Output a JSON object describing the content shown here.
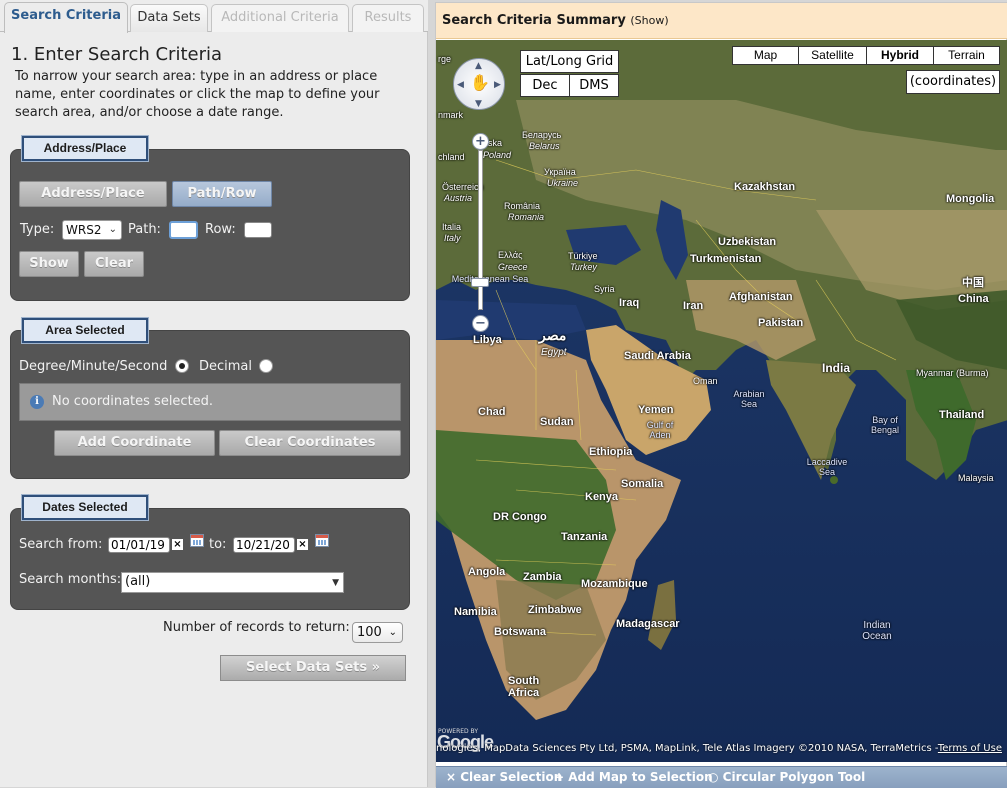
{
  "tabs": [
    {
      "label": "Search Criteria",
      "state": "active"
    },
    {
      "label": "Data Sets",
      "state": "normal"
    },
    {
      "label": "Additional Criteria",
      "state": "disabled"
    },
    {
      "label": "Results",
      "state": "disabled"
    }
  ],
  "step_title": "1. Enter Search Criteria",
  "intro_text": "To narrow your search area: type in an address or place name, enter coordinates or click the map to define your search area, and/or choose a date range.",
  "address_panel": {
    "title": "Address/Place",
    "btn_address": "Address/Place",
    "btn_pathrow": "Path/Row",
    "type_label": "Type:",
    "type_value": "WRS2",
    "path_label": "Path:",
    "path_value": "",
    "row_label": "Row:",
    "row_value": "",
    "btn_show": "Show",
    "btn_clear": "Clear"
  },
  "area_panel": {
    "title": "Area Selected",
    "dms_label": "Degree/Minute/Second",
    "dec_label": "Decimal",
    "message": "No coordinates selected.",
    "btn_add": "Add Coordinate",
    "btn_clear": "Clear Coordinates"
  },
  "dates_panel": {
    "title": "Dates Selected",
    "from_label": "Search from:",
    "from_value": "01/01/19",
    "to_label": "to:",
    "to_value": "10/21/20",
    "months_label": "Search months:",
    "months_value": "(all)"
  },
  "records_label": "Number of records to return:",
  "records_value": "100",
  "select_datasets": "Select Data Sets »",
  "summary": {
    "title": "Search Criteria Summary",
    "show": "(Show)"
  },
  "map": {
    "types": [
      "Map",
      "Satellite",
      "Hybrid",
      "Terrain"
    ],
    "active_type": "Hybrid",
    "coordinates_label": "(coordinates)",
    "grid_label": "Lat/Long Grid",
    "dec_label": "Dec",
    "dms_label": "DMS",
    "labels": {
      "kazakhstan": "Kazakhstan",
      "mongolia": "Mongolia",
      "uzbekistan": "Uzbekistan",
      "turkmenistan": "Turkmenistan",
      "afghanistan": "Afghanistan",
      "pakistan": "Pakistan",
      "china_native": "中国",
      "china": "China",
      "india": "India",
      "iraq": "Iraq",
      "iran": "Iran",
      "saudi": "Saudi Arabia",
      "oman": "Oman",
      "yemen": "Yemen",
      "libya": "Libya",
      "egypt_native": "مصر",
      "egypt": "Egypt",
      "chad": "Chad",
      "sudan": "Sudan",
      "ethiopia": "Ethiopia",
      "somalia": "Somalia",
      "kenya": "Kenya",
      "drcongo": "DR Congo",
      "tanzania": "Tanzania",
      "angola": "Angola",
      "zambia": "Zambia",
      "mozambique": "Mozambique",
      "namibia": "Namibia",
      "zimbabwe": "Zimbabwe",
      "botswana": "Botswana",
      "madagascar": "Madagascar",
      "southafrica": "South Africa",
      "thailand": "Thailand",
      "myanmar": "Myanmar (Burma)",
      "malaysia": "Malaysia",
      "belarus_native": "Беларусь",
      "belarus": "Belarus",
      "ukraine_native": "Україна",
      "ukraine": "Ukraine",
      "romania_native": "România",
      "romania": "Romania",
      "turkey_native": "Türkiye",
      "turkey": "Turkey",
      "greece_native": "Ελλάς",
      "greece": "Greece",
      "italia": "Italia",
      "italy": "Italy",
      "syria": "Syria",
      "osterreich": "Österreich",
      "austria": "Austria",
      "deutschland": "chland",
      "poland": "Poland",
      "denmark": "nmark",
      "sverige": "rge",
      "polska": "lska",
      "mediterranean": "Mediterranean Sea",
      "arabian_sea": "Arabian Sea",
      "bay_of_bengal": "Bay of Bengal",
      "laccadive": "Laccadive Sea",
      "indian_ocean": "Indian Ocean",
      "gulf_aden": "Gulf of Aden"
    },
    "powered_by": "POWERED BY",
    "google": "Google",
    "attribution": "nologies, MapData Sciences Pty Ltd, PSMA, MapLink, Tele Atlas Imagery ©2010 NASA, TerraMetrics  -",
    "terms": "Terms of Use"
  },
  "toolbar": {
    "clear_selection": "Clear Selection",
    "add_map": "Add Map to Selection",
    "circular": "Circular Polygon Tool"
  }
}
